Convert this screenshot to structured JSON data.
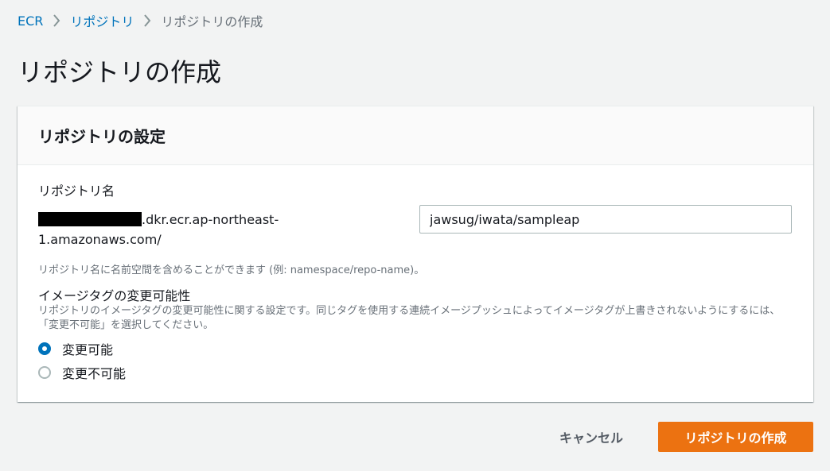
{
  "breadcrumb": {
    "items": [
      "ECR",
      "リポジトリ",
      "リポジトリの作成"
    ]
  },
  "page": {
    "title": "リポジトリの作成"
  },
  "panel": {
    "title": "リポジトリの設定",
    "repo_name_label": "リポジトリ名",
    "uri_suffix_line1": ".dkr.ecr.ap-northeast-",
    "uri_suffix_line2": "1.amazonaws.com/",
    "repo_name_value": "jawsug/iwata/sampleap",
    "repo_name_hint": "リポジトリ名に名前空間を含めることができます (例: namespace/repo-name)。",
    "tag_mutability": {
      "label": "イメージタグの変更可能性",
      "description": "リポジトリのイメージタグの変更可能性に関する設定です。同じタグを使用する連続イメージプッシュによってイメージタグが上書きされないようにするには、「変更不可能」を選択してください。",
      "options": [
        {
          "label": "変更可能",
          "selected": true
        },
        {
          "label": "変更不可能",
          "selected": false
        }
      ]
    }
  },
  "actions": {
    "cancel_label": "キャンセル",
    "create_label": "リポジトリの作成"
  },
  "colors": {
    "link": "#0073bb",
    "primary_button": "#ec7211",
    "radio_selected": "#0073bb"
  }
}
